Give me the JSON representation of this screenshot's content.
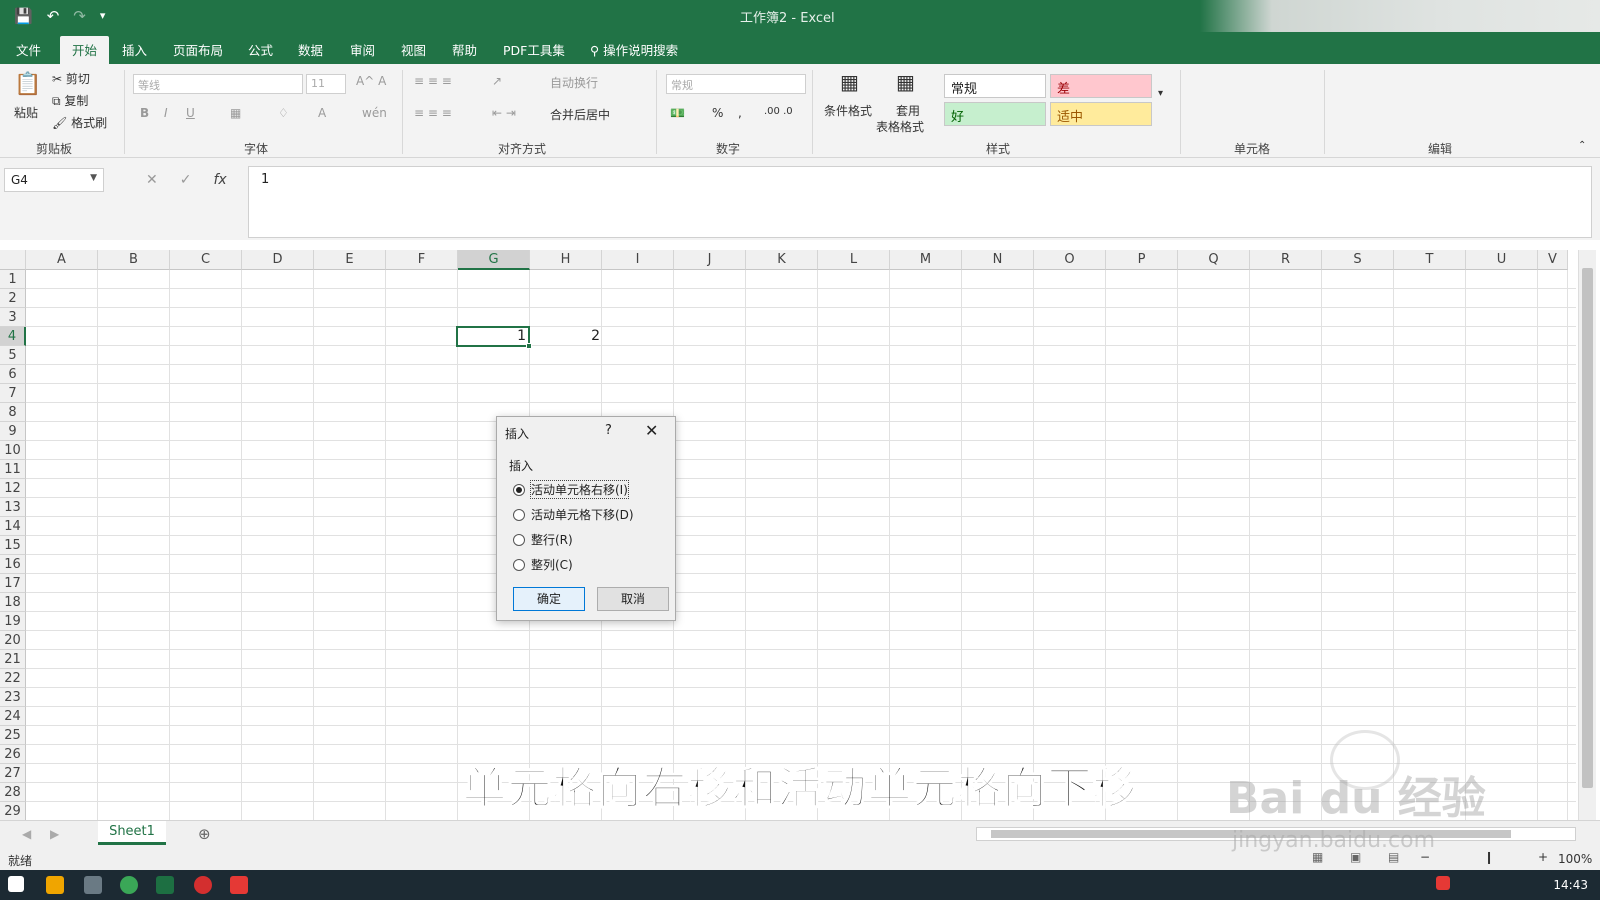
{
  "titlebar": {
    "title": "工作簿2  -  Excel"
  },
  "tabs": [
    "文件",
    "开始",
    "插入",
    "页面布局",
    "公式",
    "数据",
    "审阅",
    "视图",
    "帮助",
    "PDF工具集",
    "操作说明搜索"
  ],
  "ribbon": {
    "clipboard": {
      "paste": "粘贴",
      "cut": "剪切",
      "copy": "复制",
      "format_painter": "格式刷",
      "label": "剪贴板"
    },
    "font": {
      "name": "等线",
      "size": "11",
      "label": "字体"
    },
    "align": {
      "wrap": "自动换行",
      "merge": "合并后居中",
      "label": "对齐方式"
    },
    "number": {
      "format": "常规",
      "label": "数字"
    },
    "styles": {
      "cond": "条件格式",
      "table1": "套用",
      "table2": "表格格式",
      "normal": "常规",
      "bad": "差",
      "good": "好",
      "neutral": "适中",
      "label": "样式"
    },
    "cells": {
      "label": "单元格"
    },
    "edit": {
      "label": "编辑"
    }
  },
  "formula": {
    "namebox": "G4",
    "value": "1"
  },
  "grid": {
    "columns": [
      "A",
      "B",
      "C",
      "D",
      "E",
      "F",
      "G",
      "H",
      "I",
      "J",
      "K",
      "L",
      "M",
      "N",
      "O",
      "P",
      "Q",
      "R",
      "S",
      "T",
      "U",
      "V"
    ],
    "rows": [
      "1",
      "2",
      "3",
      "4",
      "5",
      "6",
      "7",
      "8",
      "9",
      "10",
      "11",
      "12",
      "13",
      "14",
      "15",
      "16",
      "17",
      "18",
      "19",
      "20",
      "21",
      "22",
      "23",
      "24",
      "25",
      "26",
      "27",
      "28",
      "29"
    ],
    "g4": "1",
    "h4": "2"
  },
  "dialog": {
    "title": "插入",
    "help": "?",
    "group": "插入",
    "options": [
      "活动单元格右移(I)",
      "活动单元格下移(D)",
      "整行(R)",
      "整列(C)"
    ],
    "ok": "确定",
    "cancel": "取消"
  },
  "sheet": {
    "tab": "Sheet1"
  },
  "status": {
    "ready": "就绪",
    "zoom": "100%"
  },
  "taskbar": {
    "time": "14:43"
  },
  "subtitle": "单元格向右移和活动单元格向下移",
  "watermark": {
    "brand": "Bai du 经验",
    "url": "jingyan.baidu.com"
  },
  "colors": {
    "excel_green": "#217346",
    "bad": "#ffc7ce",
    "good": "#c6efce",
    "neutral": "#ffeb9c"
  }
}
